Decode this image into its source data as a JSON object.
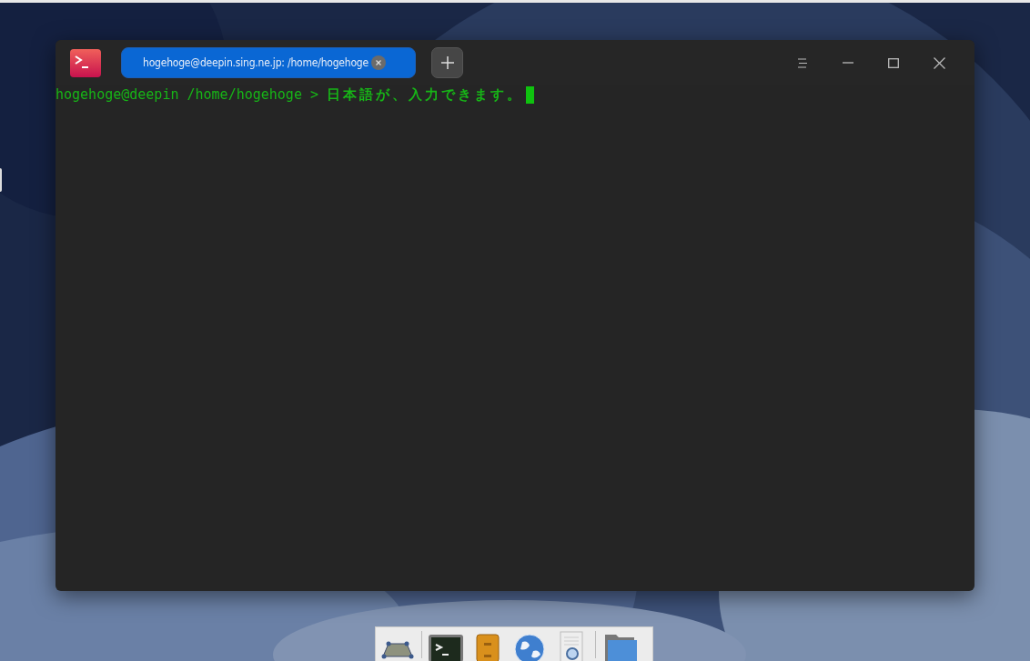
{
  "window": {
    "tabs": [
      {
        "label": "hogehoge@deepin.sing.ne.jp: /home/hogehoge",
        "selected": true
      }
    ]
  },
  "terminal": {
    "prompt": "hogehoge@deepin /home/hogehoge >",
    "input": "日本語が、入力できます。"
  }
}
